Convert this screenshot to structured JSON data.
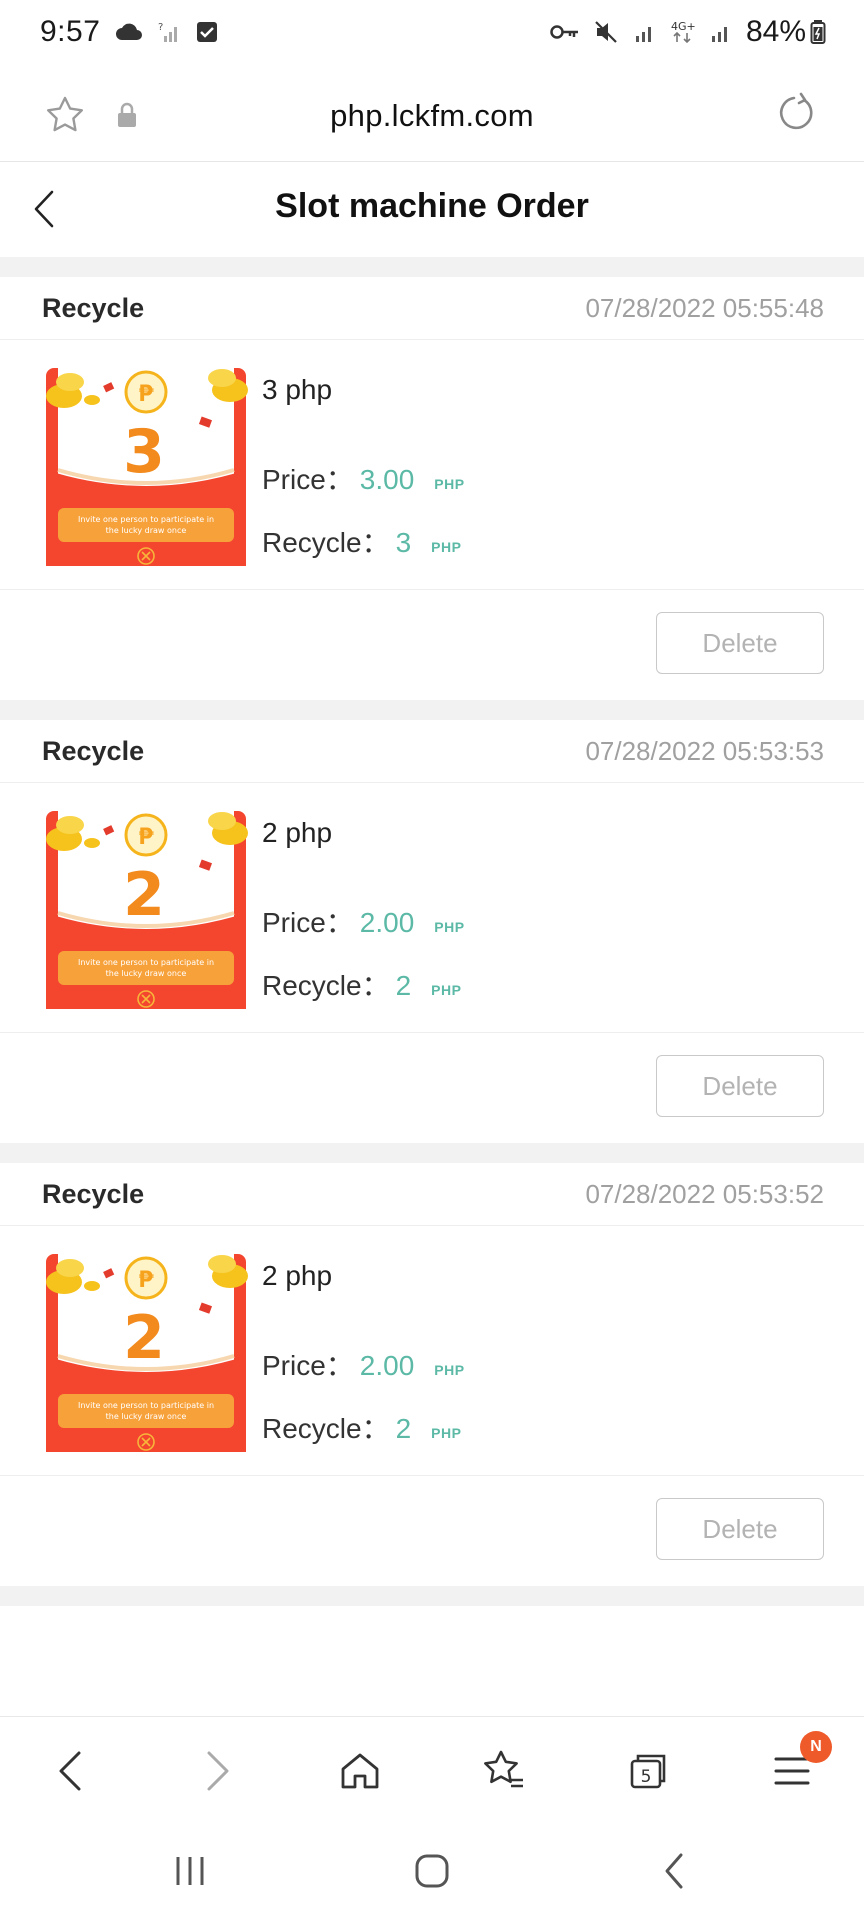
{
  "status_bar": {
    "time": "9:57",
    "battery": "84%",
    "network": "4G+"
  },
  "browser": {
    "url": "php.lckfm.com"
  },
  "page": {
    "title": "Slot machine Order"
  },
  "labels": {
    "price": "Price：",
    "recycle": "Recycle：",
    "currency": "PHP",
    "delete": "Delete"
  },
  "orders": [
    {
      "status": "Recycle",
      "timestamp": "07/28/2022 05:55:48",
      "product_name": "3 php",
      "price": "3.00",
      "recycle_value": "3",
      "thumb_number": "3",
      "thumb_caption": "Invite one person to participate in the lucky draw once"
    },
    {
      "status": "Recycle",
      "timestamp": "07/28/2022 05:53:53",
      "product_name": "2 php",
      "price": "2.00",
      "recycle_value": "2",
      "thumb_number": "2",
      "thumb_caption": "Invite one person to participate in the lucky draw once"
    },
    {
      "status": "Recycle",
      "timestamp": "07/28/2022 05:53:52",
      "product_name": "2 php",
      "price": "2.00",
      "recycle_value": "2",
      "thumb_number": "2",
      "thumb_caption": "Invite one person to participate in the lucky draw once"
    }
  ],
  "toolbar": {
    "notification_badge": "N",
    "tabs_count": "5"
  },
  "colors": {
    "accent": "#5bb9a6",
    "badge": "#ef5a2a",
    "card_red": "#f4452f",
    "coin": "#f6c21c"
  }
}
